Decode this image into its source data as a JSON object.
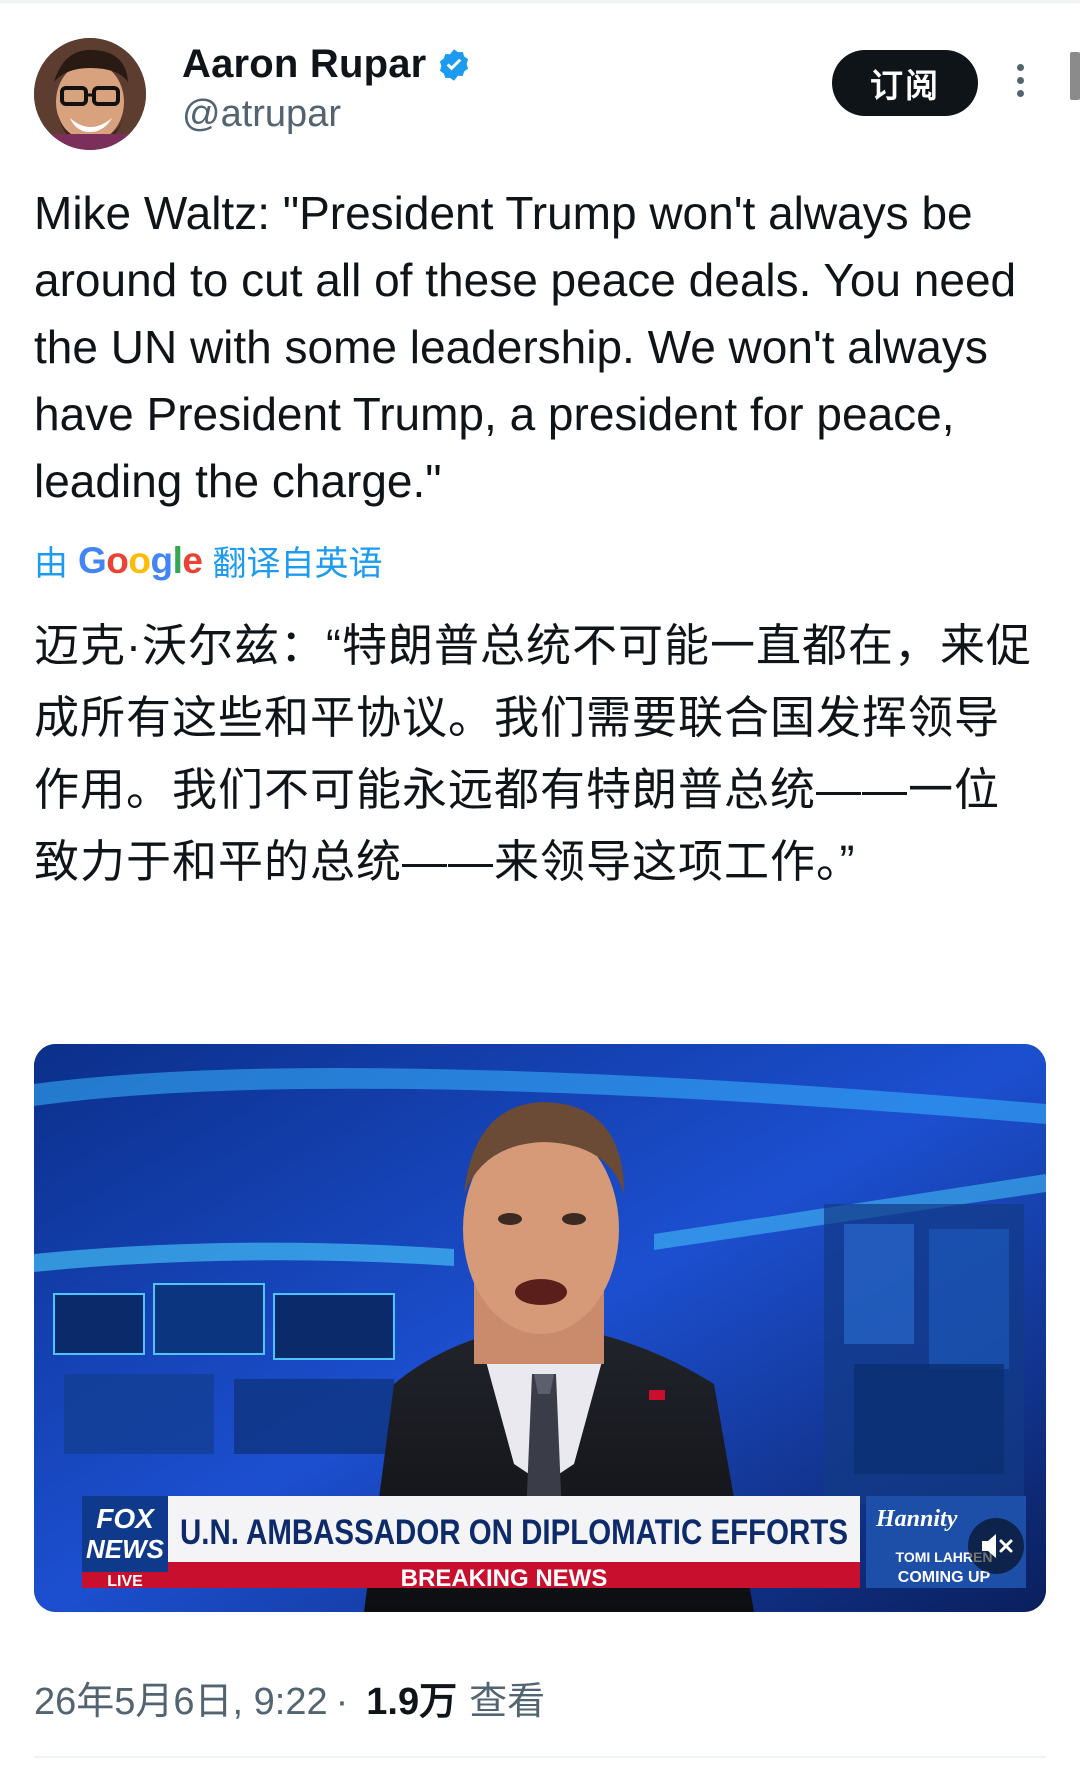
{
  "author": {
    "name": "Aaron Rupar",
    "handle": "@atrupar",
    "verified": true,
    "accent_color": "#1d9bf0"
  },
  "actions": {
    "subscribe_label": "订阅",
    "more_icon": "more-vertical-icon"
  },
  "post": {
    "text_en": "Mike Waltz: \"President Trump won't always be around to cut all of these peace deals. You need the UN with some leadership. We won't always have President Trump, a president for peace, leading the charge.\"",
    "translation": {
      "prefix": "由",
      "brand": "Google",
      "suffix": "翻译自英语"
    },
    "text_zh": "迈克·沃尔兹：“特朗普总统不可能一直都在，来促成所有这些和平协议。我们需要联合国发挥领导作用。我们不可能永远都有特朗普总统——一位致力于和平的总统——来领导这项工作。”"
  },
  "video": {
    "network_line1": "FOX",
    "network_line2": "NEWS",
    "network_line3": "LIVE",
    "headline": "U.N. AMBASSADOR ON DIPLOMATIC EFFORTS",
    "banner": "BREAKING NEWS",
    "promo_show": "Hannity",
    "promo_line1": "TOMI LAHREN",
    "promo_line2": "COMING UP",
    "muted": true
  },
  "meta": {
    "date": "26年5月6日, 9:22",
    "separator": "·",
    "views": "1.9万",
    "views_label": "查看"
  }
}
